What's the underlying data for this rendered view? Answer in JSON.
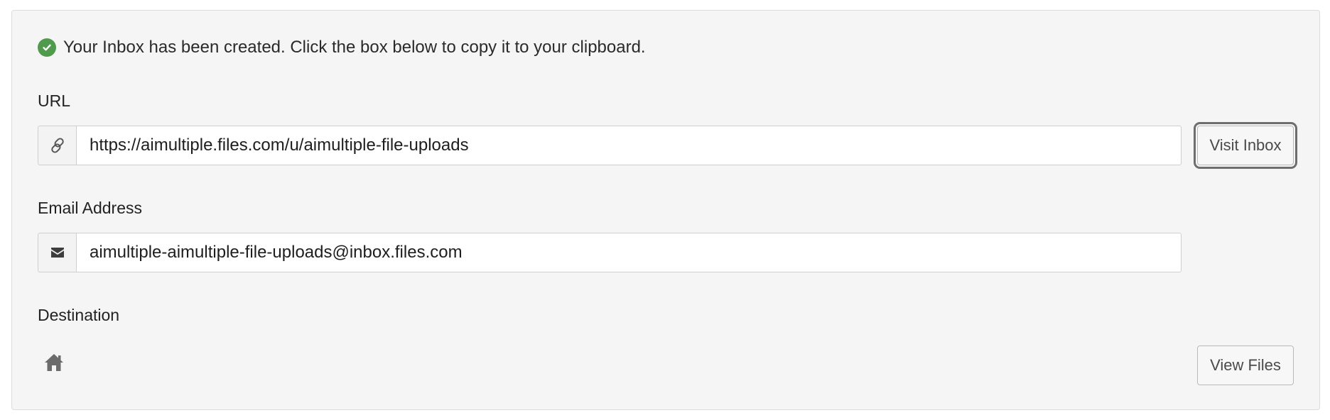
{
  "notice": {
    "text": "Your Inbox has been created. Click the box below to copy it to your clipboard.",
    "icon": "check-circle-icon",
    "icon_color": "#4f9a4c"
  },
  "url_section": {
    "label": "URL",
    "icon": "link-icon",
    "value": "https://aimultiple.files.com/u/aimultiple-file-uploads",
    "button_label": "Visit Inbox"
  },
  "email_section": {
    "label": "Email Address",
    "icon": "envelope-icon",
    "value": "aimultiple-aimultiple-file-uploads@inbox.files.com"
  },
  "destination_section": {
    "label": "Destination",
    "icon": "home-icon",
    "button_label": "View Files"
  },
  "colors": {
    "panel_background": "#f6f5f6",
    "success": "#4f9a4c"
  }
}
